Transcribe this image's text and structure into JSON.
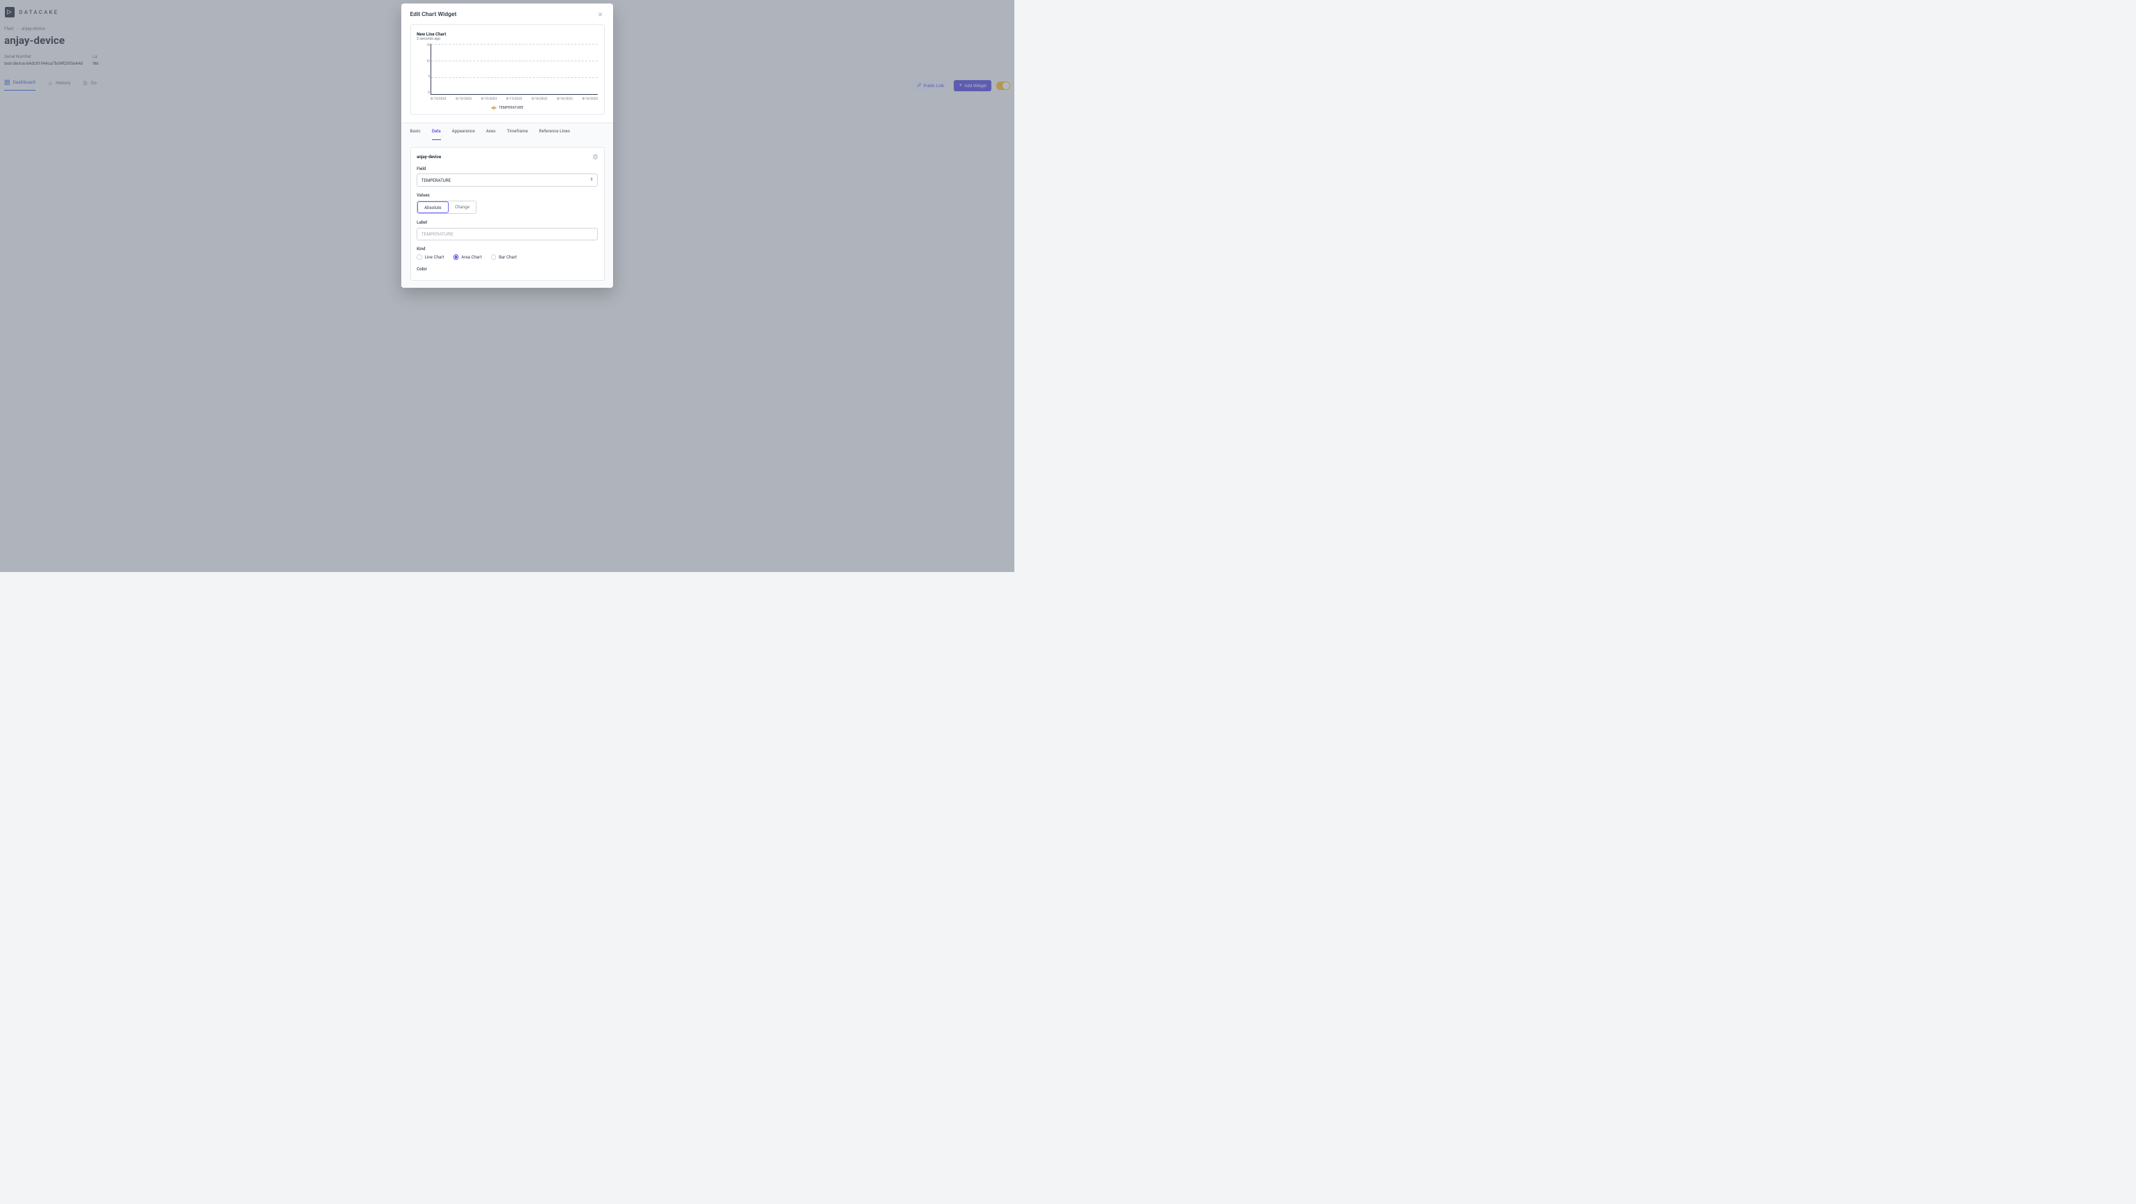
{
  "brand": {
    "name": "DATACAKE"
  },
  "breadcrumbs": {
    "root": "Fleet",
    "current": "anjay-device"
  },
  "page": {
    "title": "anjay-device"
  },
  "meta": {
    "serial_label": "Serial Number",
    "serial_value": "test-device-64dc81944ca7bd4f0395e44d",
    "last_label": "La",
    "last_value": "We"
  },
  "tabs": {
    "dashboard": "Dashboard",
    "history": "History",
    "downlinks": "Do"
  },
  "actions": {
    "public_link": "Public Link",
    "add_widget": "Add Widget"
  },
  "modal": {
    "title": "Edit Chart Widget",
    "preview": {
      "title": "New Line Chart",
      "subtitle": "2 seconds ago",
      "legend": "TEMPERATURE"
    },
    "tabs": {
      "basic": "Basic",
      "data": "Data",
      "appearance": "Appearance",
      "axes": "Axes",
      "timeframe": "Timeframe",
      "reference_lines": "Reference Lines"
    },
    "data_section": {
      "device_name": "anjay-device",
      "field_label": "Field",
      "field_value": "TEMPERATURE",
      "values_label": "Values",
      "values_absolute": "Absolute",
      "values_change": "Change",
      "label_label": "Label",
      "label_placeholder": "TEMPERATURE",
      "kind_label": "Kind",
      "kind_line": "Line Chart",
      "kind_area": "Area Chart",
      "kind_bar": "Bar Chart",
      "color_label": "Color",
      "color_placeholder": "#c67c00"
    }
  },
  "chart_data": {
    "type": "line",
    "title": "New Line Chart",
    "y_ticks": [
      0,
      5,
      10,
      15
    ],
    "x_ticks": [
      "8/15/2023",
      "8/15/2023",
      "8/15/2023",
      "8/15/2023",
      "8/16/2023",
      "8/16/2023",
      "8/16/2023"
    ],
    "series": [
      {
        "name": "TEMPERATURE",
        "color": "#c67c00",
        "values": []
      }
    ],
    "ylim": [
      0,
      17
    ]
  }
}
